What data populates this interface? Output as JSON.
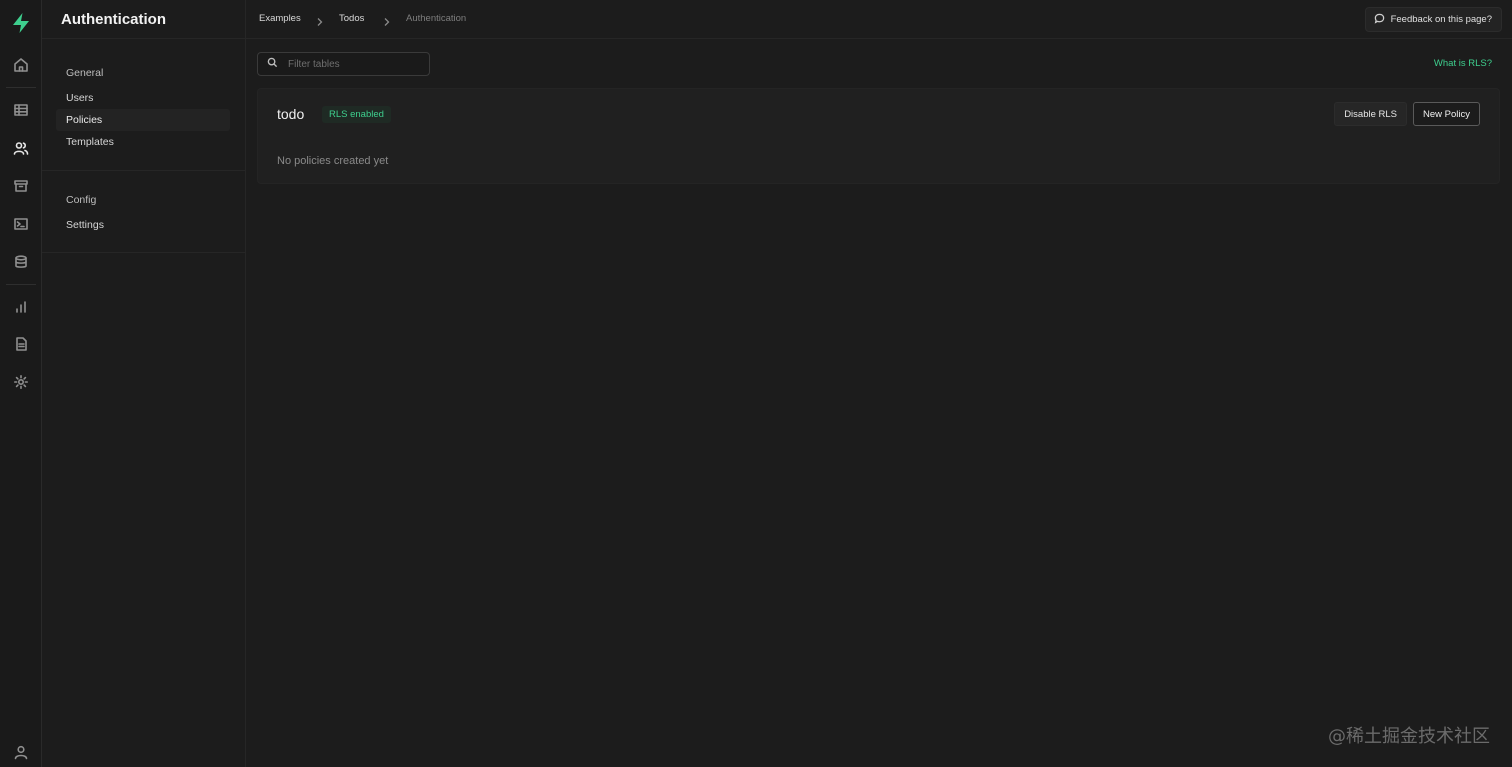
{
  "app": {
    "brand_color": "#3ecf8e",
    "background": "#1c1c1c"
  },
  "rail": {
    "items": [
      {
        "icon": "home-icon"
      },
      {
        "icon": "table-editor-icon"
      },
      {
        "icon": "users-icon",
        "active": true
      },
      {
        "icon": "storage-icon"
      },
      {
        "icon": "sql-terminal-icon"
      },
      {
        "icon": "database-icon"
      },
      {
        "icon": "reports-icon"
      },
      {
        "icon": "docs-icon"
      },
      {
        "icon": "settings-icon"
      },
      {
        "icon": "profile-icon"
      }
    ]
  },
  "sidebar": {
    "title": "Authentication",
    "general_label": "General",
    "general_items": [
      {
        "label": "Users"
      },
      {
        "label": "Policies",
        "active": true
      },
      {
        "label": "Templates"
      }
    ],
    "config_label": "Config",
    "config_items": [
      {
        "label": "Settings"
      }
    ]
  },
  "breadcrumb": {
    "items": [
      "Examples",
      "Todos",
      "Authentication"
    ]
  },
  "header": {
    "feedback_label": "Feedback on this page?"
  },
  "content": {
    "search_placeholder": "Filter tables",
    "what_is_rls": "What is RLS?",
    "table_name": "todo",
    "rls_badge": "RLS enabled",
    "disable_rls_label": "Disable RLS",
    "new_policy_label": "New Policy",
    "empty_message": "No policies created yet"
  },
  "watermark": "@稀土掘金技术社区"
}
